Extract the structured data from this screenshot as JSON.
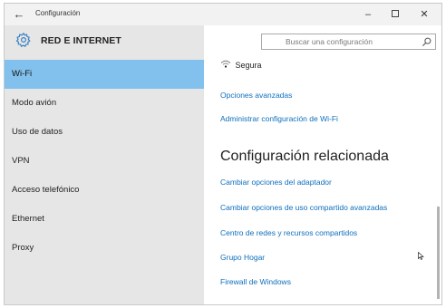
{
  "window": {
    "title": "Configuración",
    "back_glyph": "←",
    "minimize_glyph": "–",
    "close_glyph": "✕"
  },
  "sidebar": {
    "title": "RED E INTERNET",
    "items": [
      {
        "label": "Wi-Fi",
        "active": true
      },
      {
        "label": "Modo avión",
        "active": false
      },
      {
        "label": "Uso de datos",
        "active": false
      },
      {
        "label": "VPN",
        "active": false
      },
      {
        "label": "Acceso telefónico",
        "active": false
      },
      {
        "label": "Ethernet",
        "active": false
      },
      {
        "label": "Proxy",
        "active": false
      }
    ]
  },
  "search": {
    "placeholder": "Buscar una configuración"
  },
  "main": {
    "security_label": "Segura",
    "links_top": [
      "Opciones avanzadas",
      "Administrar configuración de Wi-Fi"
    ],
    "related_heading": "Configuración relacionada",
    "related_links": [
      "Cambiar opciones del adaptador",
      "Cambiar opciones de uso compartido avanzadas",
      "Centro de redes y recursos compartidos",
      "Grupo Hogar",
      "Firewall de Windows"
    ]
  },
  "colors": {
    "accent": "#82c1ee",
    "link": "#0e6fbd",
    "sidebar_bg": "#e6e6e6"
  }
}
